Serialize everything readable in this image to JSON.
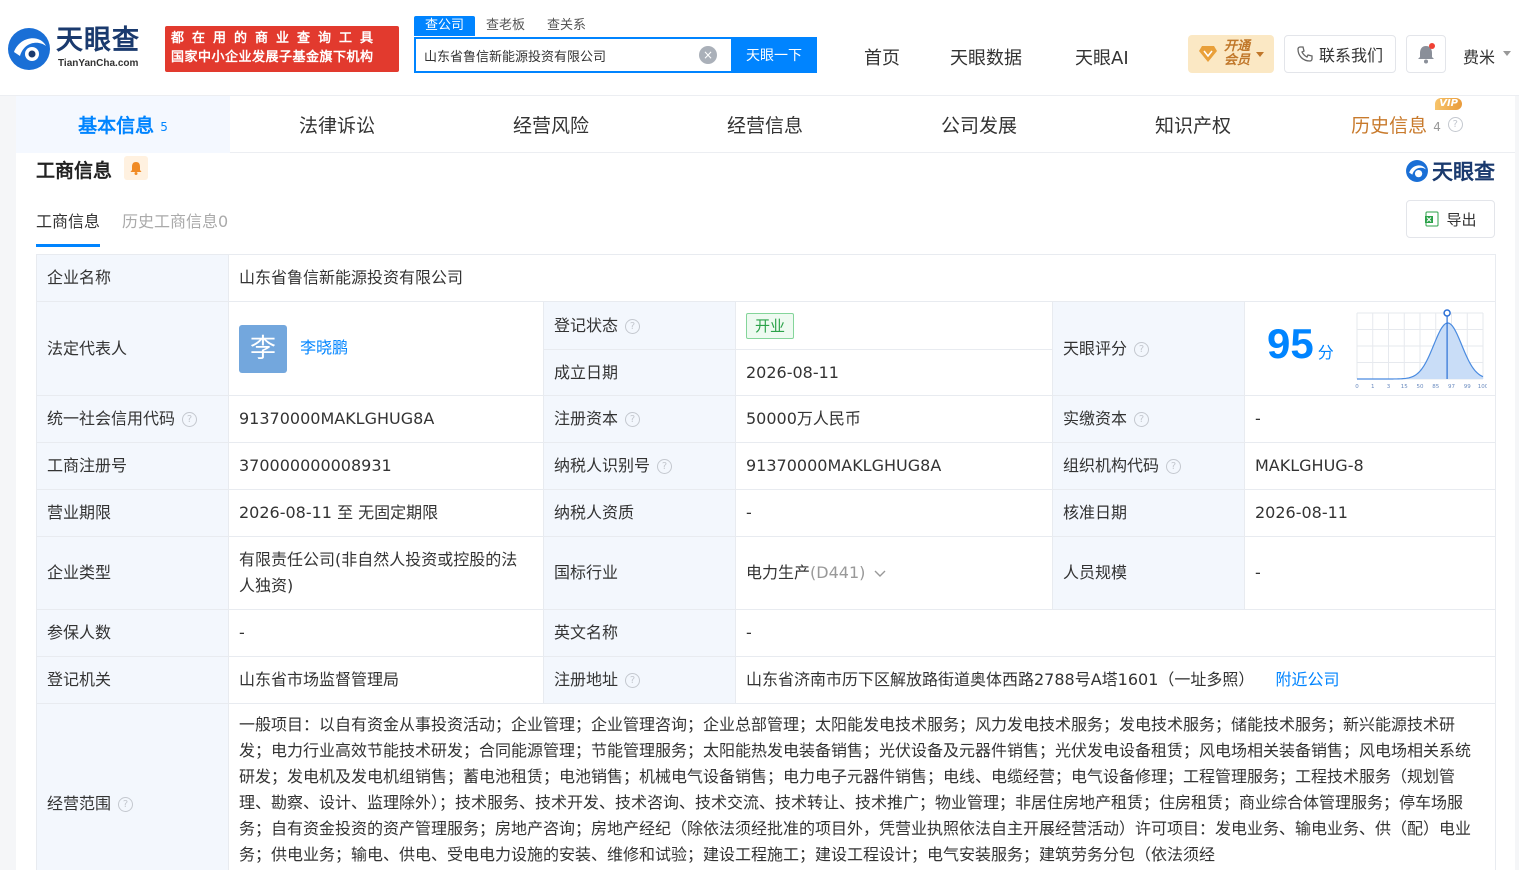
{
  "header": {
    "logo_cn": "天眼查",
    "logo_en": "TianYanCha.com",
    "slogan_line1": "都在用的商业查询工具",
    "slogan_line2": "国家中小企业发展子基金旗下机构",
    "search_tabs": [
      "查公司",
      "查老板",
      "查关系"
    ],
    "search_value": "山东省鲁信新能源投资有限公司",
    "search_button": "天眼一下",
    "nav": [
      "首页",
      "天眼数据",
      "天眼AI"
    ],
    "vip_line1": "开通",
    "vip_line2": "会员",
    "contact": "联系我们",
    "user": "费米"
  },
  "tabs": [
    {
      "label": "基本信息",
      "count": "5"
    },
    {
      "label": "法律诉讼",
      "count": ""
    },
    {
      "label": "经营风险",
      "count": ""
    },
    {
      "label": "经营信息",
      "count": ""
    },
    {
      "label": "公司发展",
      "count": ""
    },
    {
      "label": "知识产权",
      "count": ""
    },
    {
      "label": "历史信息",
      "count": "4",
      "tag": "VIP"
    }
  ],
  "section": {
    "title": "工商信息",
    "brand": "天眼查",
    "subtabs": [
      "工商信息",
      "历史工商信息0"
    ],
    "export": "导出"
  },
  "info": {
    "company_name_k": "企业名称",
    "company_name_v": "山东省鲁信新能源投资有限公司",
    "legal_rep_k": "法定代表人",
    "legal_rep_avatar": "李",
    "legal_rep_v": "李晓鹏",
    "reg_status_k": "登记状态",
    "reg_status_v": "开业",
    "found_date_k": "成立日期",
    "found_date_v": "2026-08-11",
    "score_k": "天眼评分",
    "score_v": "95",
    "score_unit": "分",
    "score_ticks": [
      "0",
      "1",
      "3",
      "15",
      "50",
      "85",
      "97",
      "99",
      "100"
    ],
    "credit_code_k": "统一社会信用代码",
    "credit_code_v": "91370000MAKLGHUG8A",
    "reg_capital_k": "注册资本",
    "reg_capital_v": "50000万人民币",
    "paid_capital_k": "实缴资本",
    "paid_capital_v": "-",
    "reg_no_k": "工商注册号",
    "reg_no_v": "370000000008931",
    "tax_id_k": "纳税人识别号",
    "tax_id_v": "91370000MAKLGHUG8A",
    "org_code_k": "组织机构代码",
    "org_code_v": "MAKLGHUG-8",
    "term_k": "营业期限",
    "term_v": "2026-08-11 至 无固定期限",
    "tax_qual_k": "纳税人资质",
    "tax_qual_v": "-",
    "approve_date_k": "核准日期",
    "approve_date_v": "2026-08-11",
    "type_k": "企业类型",
    "type_v": "有限责任公司(非自然人投资或控股的法人独资)",
    "industry_k": "国标行业",
    "industry_v": "电力生产",
    "industry_code": "(D441)",
    "staff_k": "人员规模",
    "staff_v": "-",
    "insured_k": "参保人数",
    "insured_v": "-",
    "en_name_k": "英文名称",
    "en_name_v": "-",
    "authority_k": "登记机关",
    "authority_v": "山东省市场监督管理局",
    "address_k": "注册地址",
    "address_v": "山东省济南市历下区解放路街道奥体西路2788号A塔1601（一址多照）",
    "nearby": "附近公司",
    "scope_k": "经营范围",
    "scope_v": "一般项目：以自有资金从事投资活动；企业管理；企业管理咨询；企业总部管理；太阳能发电技术服务；风力发电技术服务；发电技术服务；储能技术服务；新兴能源技术研发；电力行业高效节能技术研发；合同能源管理；节能管理服务；太阳能热发电装备销售；光伏设备及元器件销售；光伏发电设备租赁；风电场相关装备销售；风电场相关系统研发；发电机及发电机组销售；蓄电池租赁；电池销售；机械电气设备销售；电力电子元器件销售；电线、电缆经营；电气设备修理；工程管理服务；工程技术服务（规划管理、勘察、设计、监理除外）；技术服务、技术开发、技术咨询、技术交流、技术转让、技术推广；物业管理；非居住房地产租赁；住房租赁；商业综合体管理服务；停车场服务；自有资金投资的资产管理服务；房地产咨询；房地产经纪（除依法须经批准的项目外，凭营业执照依法自主开展经营活动）许可项目：发电业务、输电业务、供（配）电业务；供电业务；输电、供电、受电电力设施的安装、维修和试验；建设工程施工；建设工程设计；电气安装服务；建筑劳务分包（依法须经"
  },
  "colors": {
    "accent": "#0084ff",
    "brand_red": "#e23a2e",
    "vip_gold": "#c87a2c",
    "open_green": "#2ca24a"
  }
}
